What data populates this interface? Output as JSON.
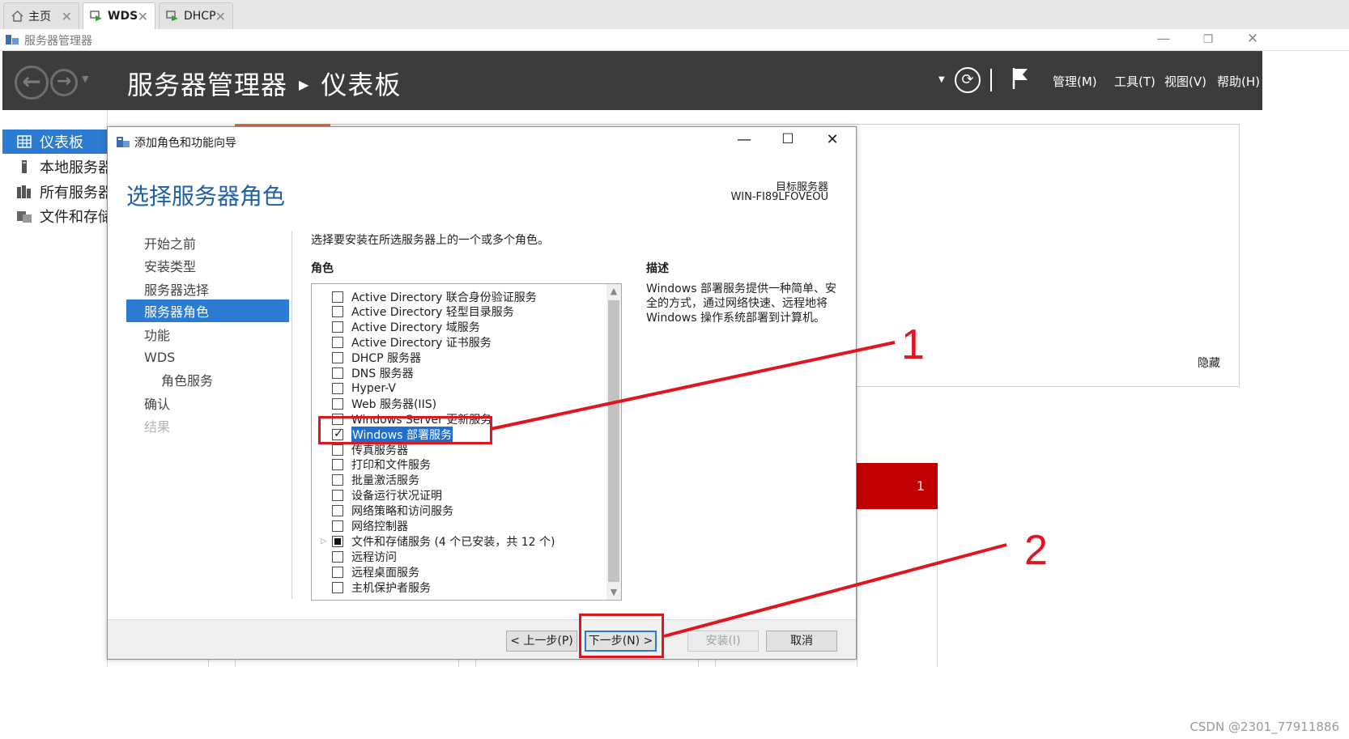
{
  "tabs": [
    {
      "label": "主页",
      "icon": "home-icon",
      "active": false
    },
    {
      "label": "WDS",
      "icon": "vm-icon",
      "active": true
    },
    {
      "label": "DHCP",
      "icon": "vm-icon",
      "active": false
    }
  ],
  "window": {
    "title": "服务器管理器"
  },
  "header": {
    "breadcrumb_root": "服务器管理器",
    "breadcrumb_current": "仪表板",
    "menu": [
      "管理(M)",
      "工具(T)",
      "视图(V)",
      "帮助(H)"
    ]
  },
  "leftnav": [
    {
      "label": "仪表板",
      "icon": "dashboard-icon",
      "selected": true
    },
    {
      "label": "本地服务器",
      "icon": "local-server-icon",
      "selected": false
    },
    {
      "label": "所有服务器",
      "icon": "all-servers-icon",
      "selected": false
    },
    {
      "label": "文件和存储",
      "icon": "file-storage-icon",
      "selected": false
    }
  ],
  "background": {
    "hide_link": "隐藏",
    "tile_count": "1"
  },
  "wizard": {
    "title": "添加角色和功能向导",
    "heading": "选择服务器角色",
    "target_label": "目标服务器",
    "target_value": "WIN-FI89LFOVEOU",
    "instruction": "选择要安装在所选服务器上的一个或多个角色。",
    "roles_label": "角色",
    "description_label": "描述",
    "description_text": "Windows 部署服务提供一种简单、安全的方式，通过网络快速、远程地将 Windows 操作系统部署到计算机。",
    "steps": [
      {
        "label": "开始之前",
        "state": "normal"
      },
      {
        "label": "安装类型",
        "state": "normal"
      },
      {
        "label": "服务器选择",
        "state": "normal"
      },
      {
        "label": "服务器角色",
        "state": "selected"
      },
      {
        "label": "功能",
        "state": "normal"
      },
      {
        "label": "WDS",
        "state": "normal"
      },
      {
        "label": "角色服务",
        "state": "sub"
      },
      {
        "label": "确认",
        "state": "normal"
      },
      {
        "label": "结果",
        "state": "disabled"
      }
    ],
    "roles": [
      {
        "label": "Active Directory 联合身份验证服务",
        "state": "unchecked"
      },
      {
        "label": "Active Directory 轻型目录服务",
        "state": "unchecked"
      },
      {
        "label": "Active Directory 域服务",
        "state": "unchecked"
      },
      {
        "label": "Active Directory 证书服务",
        "state": "unchecked"
      },
      {
        "label": "DHCP 服务器",
        "state": "unchecked"
      },
      {
        "label": "DNS 服务器",
        "state": "unchecked"
      },
      {
        "label": "Hyper-V",
        "state": "unchecked"
      },
      {
        "label": "Web 服务器(IIS)",
        "state": "unchecked"
      },
      {
        "label": "Windows Server 更新服务",
        "state": "unchecked"
      },
      {
        "label": "Windows 部署服务",
        "state": "checked",
        "highlight": true
      },
      {
        "label": "传真服务器",
        "state": "unchecked"
      },
      {
        "label": "打印和文件服务",
        "state": "unchecked"
      },
      {
        "label": "批量激活服务",
        "state": "unchecked"
      },
      {
        "label": "设备运行状况证明",
        "state": "unchecked"
      },
      {
        "label": "网络策略和访问服务",
        "state": "unchecked"
      },
      {
        "label": "网络控制器",
        "state": "unchecked"
      },
      {
        "label": "文件和存储服务 (4 个已安装，共 12 个)",
        "state": "partial",
        "expandable": true
      },
      {
        "label": "远程访问",
        "state": "unchecked"
      },
      {
        "label": "远程桌面服务",
        "state": "unchecked"
      },
      {
        "label": "主机保护者服务",
        "state": "unchecked"
      }
    ],
    "buttons": {
      "prev": "< 上一步(P)",
      "next": "下一步(N) >",
      "install": "安装(I)",
      "cancel": "取消"
    }
  },
  "annotations": {
    "label_1": "1",
    "label_2": "2",
    "color": "#e0161f"
  },
  "watermark": "CSDN @2301_77911886",
  "colors": {
    "accent": "#2b7bd3",
    "header_bg": "#3c3c3c",
    "heading": "#1f5fa8",
    "tile_red": "#c00000"
  }
}
